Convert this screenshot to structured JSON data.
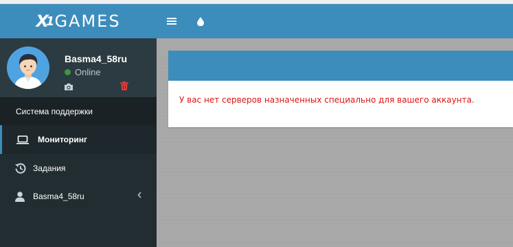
{
  "header": {
    "logo_prefix": "X",
    "logo_accent": "1",
    "logo_text": "GAMES",
    "menu_icon": "hamburger-icon",
    "theme_icon": "droplet-icon"
  },
  "user_panel": {
    "username": "Basma4_58ru",
    "status": "Online",
    "status_color": "#3c9a3c"
  },
  "sidebar": {
    "section_header": "Система поддержки",
    "items": [
      {
        "label": "Мониторинг",
        "icon": "laptop-icon",
        "active": true
      },
      {
        "label": "Задания",
        "icon": "history-icon",
        "active": false
      },
      {
        "label": "Basma4_58ru",
        "icon": "user-icon",
        "active": false
      }
    ]
  },
  "main": {
    "message": "У вас нет серверов назначенных специально для вашего аккаунта."
  },
  "colors": {
    "header": "#3c8dbc",
    "sidebar": "#222d32",
    "sidebar_dark": "#1a2226",
    "error_text": "#dd1111"
  }
}
